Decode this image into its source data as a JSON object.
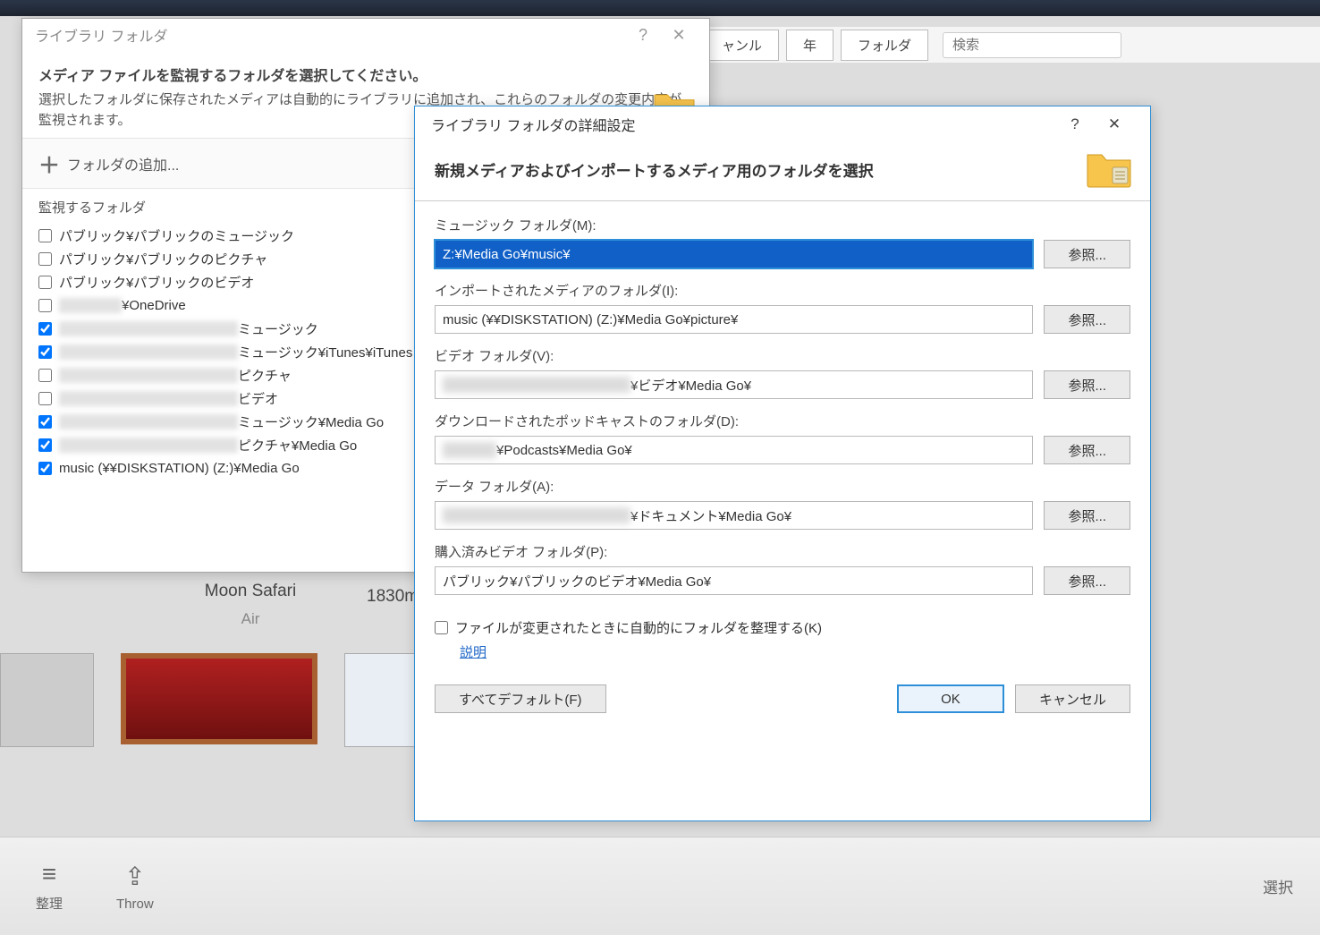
{
  "app": {
    "tabs": {
      "channel": "ャンル",
      "year": "年",
      "folder": "フォルダ"
    },
    "search_placeholder": "検索",
    "bottom": {
      "organize": "整理",
      "throw": "Throw",
      "select_label": "選択"
    },
    "album": {
      "title": "Moon Safari",
      "artist": "Air",
      "right": "1830m"
    }
  },
  "dlg1": {
    "title": "ライブラリ フォルダ",
    "heading": "メディア ファイルを監視するフォルダを選択してください。",
    "desc": "選択したフォルダに保存されたメディアは自動的にライブラリに追加され、これらのフォルダの変更内容が監視されます。",
    "add_folder": "フォルダの追加...",
    "group_header": "監視するフォルダ",
    "items": [
      {
        "checked": false,
        "label": "パブリック¥パブリックのミュージック"
      },
      {
        "checked": false,
        "label": "パブリック¥パブリックのピクチャ"
      },
      {
        "checked": false,
        "label": "パブリック¥パブリックのビデオ"
      },
      {
        "checked": false,
        "label": "",
        "blur_w": 70,
        "suffix": "¥OneDrive"
      },
      {
        "checked": true,
        "label": "",
        "blur_w": 200,
        "suffix": "ミュージック"
      },
      {
        "checked": true,
        "label": "",
        "blur_w": 200,
        "suffix": "ミュージック¥iTunes¥iTunes M"
      },
      {
        "checked": false,
        "label": "",
        "blur_w": 200,
        "suffix": "ピクチャ"
      },
      {
        "checked": false,
        "label": "",
        "blur_w": 200,
        "suffix": "ビデオ"
      },
      {
        "checked": true,
        "label": "",
        "blur_w": 200,
        "suffix": "ミュージック¥Media Go"
      },
      {
        "checked": true,
        "label": "",
        "blur_w": 200,
        "suffix": "ピクチャ¥Media Go"
      },
      {
        "checked": true,
        "label": "music (¥¥DISKSTATION) (Z:)¥Media Go"
      }
    ]
  },
  "dlg2": {
    "title": "ライブラリ フォルダの詳細設定",
    "header": "新規メディアおよびインポートするメディア用のフォルダを選択",
    "browse": "参照...",
    "fields": {
      "music": {
        "label": "ミュージック フォルダ(M):",
        "value": "Z:¥Media Go¥music¥"
      },
      "import": {
        "label": "インポートされたメディアのフォルダ(I):",
        "value": "music (¥¥DISKSTATION) (Z:)¥Media Go¥picture¥"
      },
      "video": {
        "label": "ビデオ フォルダ(V):",
        "value_suffix": "¥ビデオ¥Media Go¥",
        "blur_w": 210
      },
      "podcast": {
        "label": "ダウンロードされたポッドキャストのフォルダ(D):",
        "value_suffix": "¥Podcasts¥Media Go¥",
        "blur_w": 60
      },
      "data": {
        "label": "データ フォルダ(A):",
        "value_suffix": "¥ドキュメント¥Media Go¥",
        "blur_w": 210
      },
      "pvideo": {
        "label": "購入済みビデオ フォルダ(P):",
        "value": "パブリック¥パブリックのビデオ¥Media Go¥"
      }
    },
    "auto_organize": "ファイルが変更されたときに自動的にフォルダを整理する(K)",
    "explain": "説明",
    "all_default": "すべてデフォルト(F)",
    "ok": "OK",
    "cancel": "キャンセル"
  }
}
